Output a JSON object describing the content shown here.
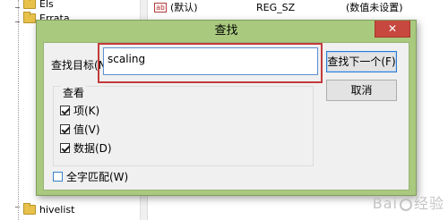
{
  "tree": {
    "items": [
      {
        "label": "Els"
      },
      {
        "label": "Errata"
      },
      {
        "label": "hivelist"
      }
    ]
  },
  "values_list": {
    "rows": [
      {
        "name": "(默认)",
        "type": "REG_SZ",
        "data": "(数值未设置)",
        "icon": "ab-icon"
      }
    ]
  },
  "dialog": {
    "title": "查找",
    "close_label": "✕",
    "find_label": "查找目标(N):",
    "find_value": "scaling",
    "find_next_label": "查找下一个(F)",
    "cancel_label": "取消",
    "look_at_label": "查看",
    "options": [
      {
        "label": "项(K)",
        "checked": true
      },
      {
        "label": "值(V)",
        "checked": true
      },
      {
        "label": "数据(D)",
        "checked": true
      }
    ],
    "match_whole_label": "全字匹配(W)",
    "match_whole_checked": false
  },
  "watermark": {
    "text_left": "Bai",
    "text_right": "经验"
  },
  "colors": {
    "dialog_frame": "#a9c97e",
    "highlight": "#c33b3b",
    "close_button": "#c7483f",
    "input_border": "#5e8fd0"
  }
}
